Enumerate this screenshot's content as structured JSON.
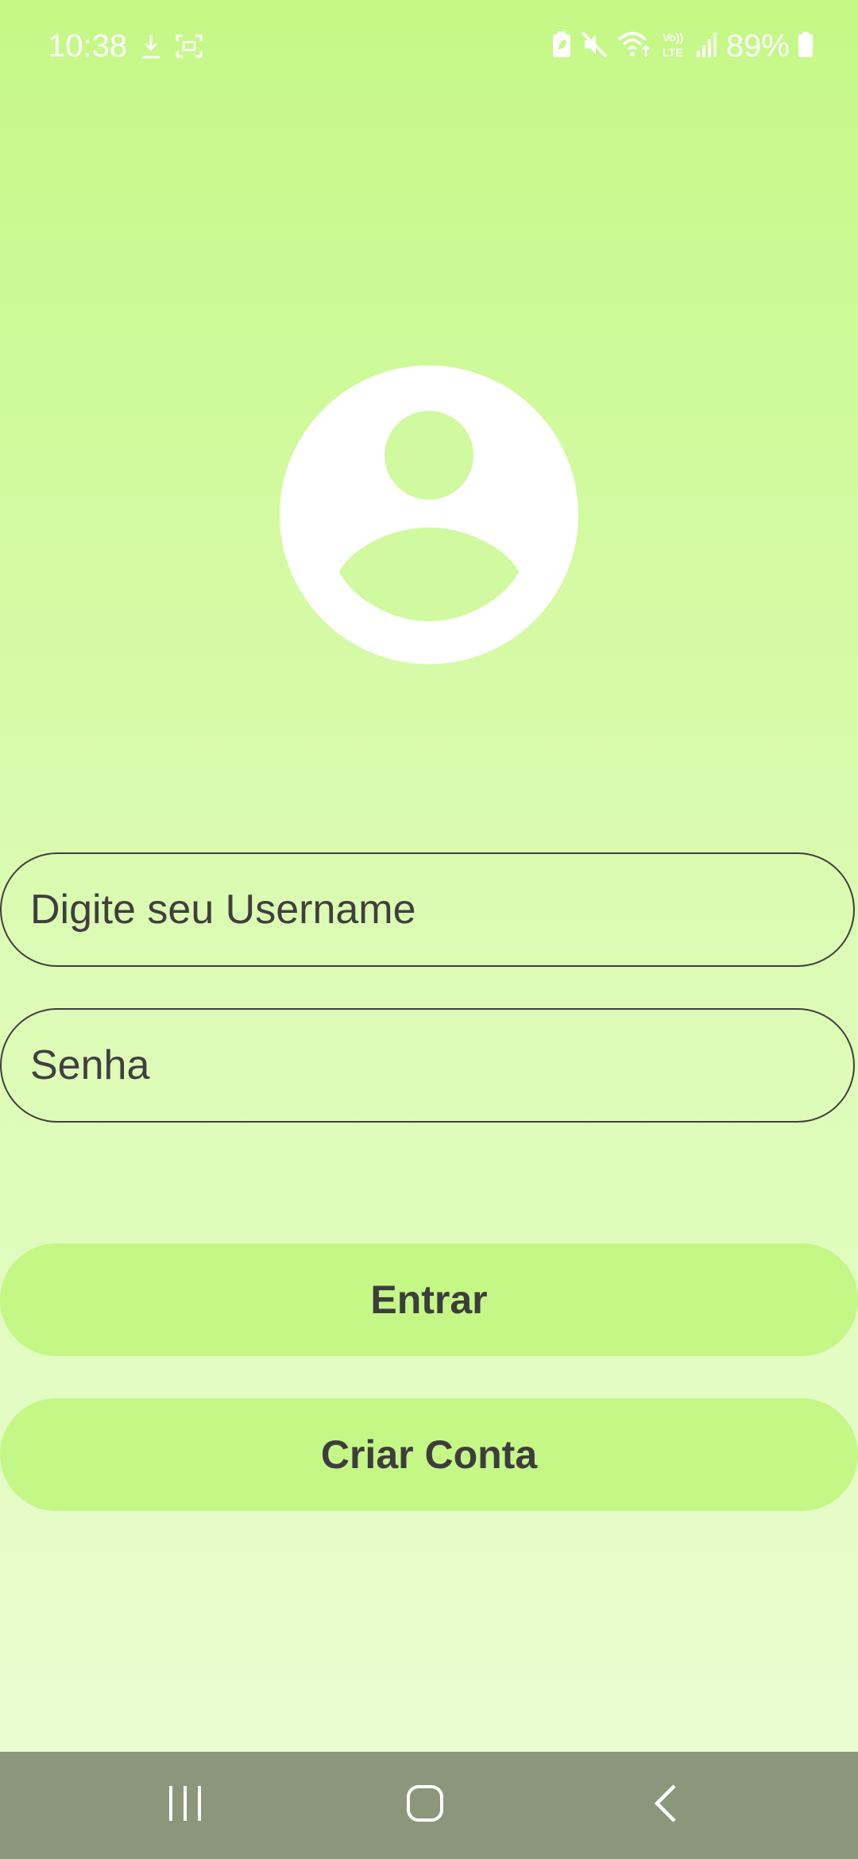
{
  "status_bar": {
    "time": "10:38",
    "battery_percent": "89%",
    "icons": [
      "download-icon",
      "screenshot-icon",
      "battery-saver-icon",
      "mute-icon",
      "wifi-icon",
      "volte-icon",
      "signal-icon",
      "battery-icon"
    ]
  },
  "avatar": {
    "icon": "user-avatar-icon"
  },
  "form": {
    "username_placeholder": "Digite seu Username",
    "username_value": "",
    "password_placeholder": "Senha",
    "password_value": ""
  },
  "buttons": {
    "login_label": "Entrar",
    "create_account_label": "Criar Conta"
  },
  "nav_bar": {
    "icons": [
      "recents-icon",
      "home-icon",
      "back-icon"
    ]
  },
  "colors": {
    "background_top": "#c5f887",
    "background_bottom": "#ecfdd4",
    "button_fill": "#c4f785",
    "text": "#3f3f3f",
    "nav_bar": "#8a977b"
  }
}
